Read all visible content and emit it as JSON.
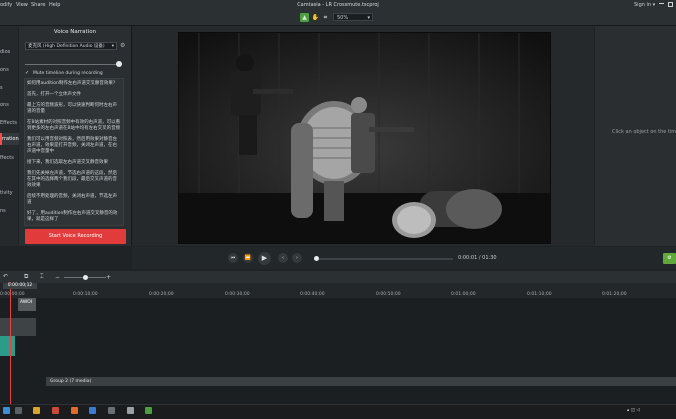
{
  "menubar": {
    "items": [
      "odify",
      "View",
      "Share",
      "Help"
    ],
    "title": "Camtasia - LR Crossmute.tscproj",
    "sign_in": "Sign in",
    "sign_in_caret": "▾"
  },
  "toolbar": {
    "zoom": "50%",
    "zoom_caret": "▾"
  },
  "leftnav": {
    "items": [
      "dios",
      "ons",
      "s",
      "ons",
      "Effects",
      "ffects",
      "rration",
      "ffects",
      "tivity",
      "ns"
    ],
    "active_index": 6
  },
  "voice_panel": {
    "title": "Voice Narration",
    "mic": "麦克风 (High Definition Audio 设备)",
    "mic_caret": "▾",
    "volume_level": 0.95,
    "mute_label": "Mute timeline during recording",
    "mute_checked": true,
    "script_paragraphs": [
      "如何用audition制作左右声道交叉静音效果?",
      "首先，打开一个立体声文件",
      "最上方的音频波形，可以快速判断何时左右声道的音量",
      "在B站素材的对照音频中有效的右声道，可以看到更多的左右声道在B站中均有左右交叉的音频",
      "我们可以用音频对照表，然后用效果对静音左右声道，效果是打开音频，关闭左声道，在右声道中音量中",
      "接下来，我们选取左右声道交叉静音效果",
      "我们先关掉左声道，节选右声道的这段，然后在其中的选择两个我们段，最后交叉声道的音效效果",
      "后续不用处理的音频，关闭右声道，节选左声道",
      "好了，用audition制作左右声道交叉静音的效果，就是这样了"
    ],
    "record_button": "Start Voice Recording"
  },
  "properties": {
    "message": "Click an object on the tim or canvas to show its Pro"
  },
  "playback": {
    "time_current": "0:00:01",
    "time_total": "01:30",
    "progress": 0.01,
    "buttons": [
      "prev",
      "rewind",
      "play",
      "back",
      "next"
    ]
  },
  "timeline": {
    "playhead_time": "0:00:00;12",
    "ticks": [
      "0:00:00;00",
      "0:00:10;00",
      "0:00:20;00",
      "0:00:30;00",
      "0:00:40;00",
      "0:00:50;00",
      "0:01:00;00",
      "0:01:10;00",
      "0:01:20;00"
    ],
    "clip_label": "AWOI",
    "group_label": "Group 2",
    "group_count": "(7 media)"
  },
  "colors": {
    "accent_red": "#e23b3b",
    "export_green": "#5fa83a",
    "clip_teal": "#2c9b8a"
  }
}
